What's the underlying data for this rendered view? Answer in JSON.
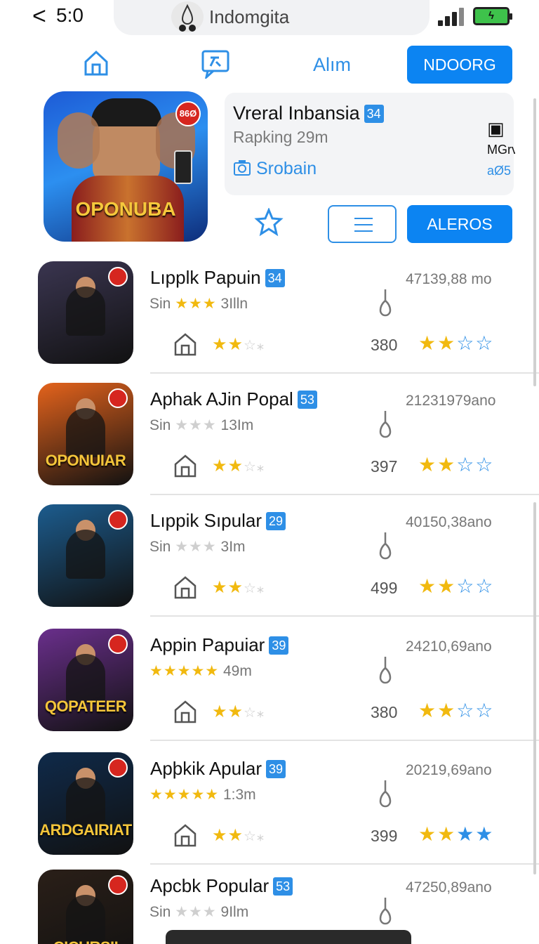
{
  "status": {
    "back": "<",
    "time": "5:0",
    "site": "Indomgita"
  },
  "nav": {
    "home_icon": "home-icon",
    "chat_icon": "chat-icon",
    "tab_label": "Alım",
    "button_label": "NDOORG"
  },
  "featured": {
    "cover_caption": "OPONUBA",
    "cover_badge": "86Ø",
    "title": "Vreral Inbansia",
    "title_badge": "34",
    "subtitle": "Rapking 29m",
    "link": "Srobain",
    "side_line1": "MGrv",
    "side_line2": "aØ5",
    "action_button": "ALEROS"
  },
  "apps": [
    {
      "title": "Lıpplk Papuin",
      "badge": "34",
      "sub_prefix": "Sin",
      "stars_filled": 3,
      "stars_text": "★★★",
      "size": "3Illn",
      "metric": "47139,88 mo",
      "count": "380",
      "caption": "",
      "cover_color": "#3a3550"
    },
    {
      "title": "Aphak AJin Popal",
      "badge": "53",
      "sub_prefix": "Sin",
      "stars_filled": 0,
      "stars_text": "★★★",
      "size": "13Im",
      "metric": "21231979ano",
      "count": "397",
      "caption": "OPONUIAR",
      "cover_color": "#e4631c"
    },
    {
      "title": "Lıppik Sıpular",
      "badge": "29",
      "sub_prefix": "Sin",
      "stars_filled": 0,
      "stars_text": "★★★",
      "size": "3Im",
      "metric": "40150,38ano",
      "count": "499",
      "caption": "",
      "cover_color": "#1c5c8e"
    },
    {
      "title": "Appin Papuiar",
      "badge": "39",
      "sub_prefix": "",
      "stars_filled": 5,
      "stars_text": "★★★★★",
      "size": "49m",
      "metric": "24210,69ano",
      "count": "380",
      "caption": "QOPATEER",
      "cover_color": "#6a2f8c"
    },
    {
      "title": "Apþkik Apular",
      "badge": "39",
      "sub_prefix": "",
      "stars_filled": 5,
      "stars_text": "★★★★★",
      "size": "1:3m",
      "metric": "20219,69ano",
      "count": "399",
      "caption": "ARDGAIRIAT",
      "cover_color": "#0f2a4a"
    },
    {
      "title": "Apcbk Popular",
      "badge": "53",
      "sub_prefix": "Sin",
      "stars_filled": 0,
      "stars_text": "★★★",
      "size": "9Ilm",
      "metric": "47250,89ano",
      "count": "",
      "caption": "CICURSII",
      "cover_color": "#2a1f18"
    }
  ],
  "colors": {
    "accent": "#0c84f2",
    "star": "#f1b90f",
    "link": "#2e8fe6"
  }
}
